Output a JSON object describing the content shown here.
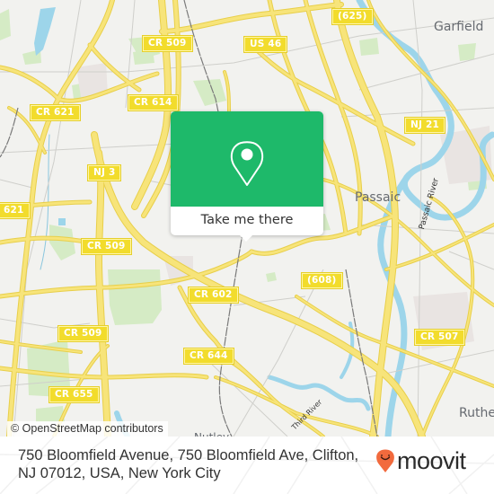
{
  "map": {
    "attribution": "© OpenStreetMap contributors",
    "colors": {
      "land": "#f2f2ef",
      "road": "#f5e06a",
      "road_casing": "#e8cf4a",
      "water": "#9dd5ea",
      "park": "#d5ebc5",
      "rail": "#7a7a7a",
      "minor_road": "#c9c9c5",
      "shield_bg": "#f2dc2c"
    },
    "road_labels": [
      "CR 509",
      "US 46",
      "(625)",
      "CR 614",
      "CR 621",
      "NJ 3",
      "NJ 21",
      "621",
      "CR 509",
      "CR 602",
      "(608)",
      "CR 509",
      "CR 644",
      "CR 507",
      "CR 655"
    ],
    "place_labels": [
      "Garfield",
      "Passaic",
      "Nutley",
      "Ruthe"
    ],
    "water_labels": [
      "Passaic River",
      "Third River"
    ]
  },
  "popup": {
    "icon": "location-pin-icon",
    "button_label": "Take me there",
    "accent_color": "#1eb96a"
  },
  "footer": {
    "address_line1": "750 Bloomfield Avenue, 750 Bloomfield Ave, Clifton,",
    "address_line2": "NJ 07012, USA, New York City",
    "brand": "moovit",
    "brand_icon": "moovit-smiley-pin-icon",
    "brand_color": "#f26a3d"
  }
}
